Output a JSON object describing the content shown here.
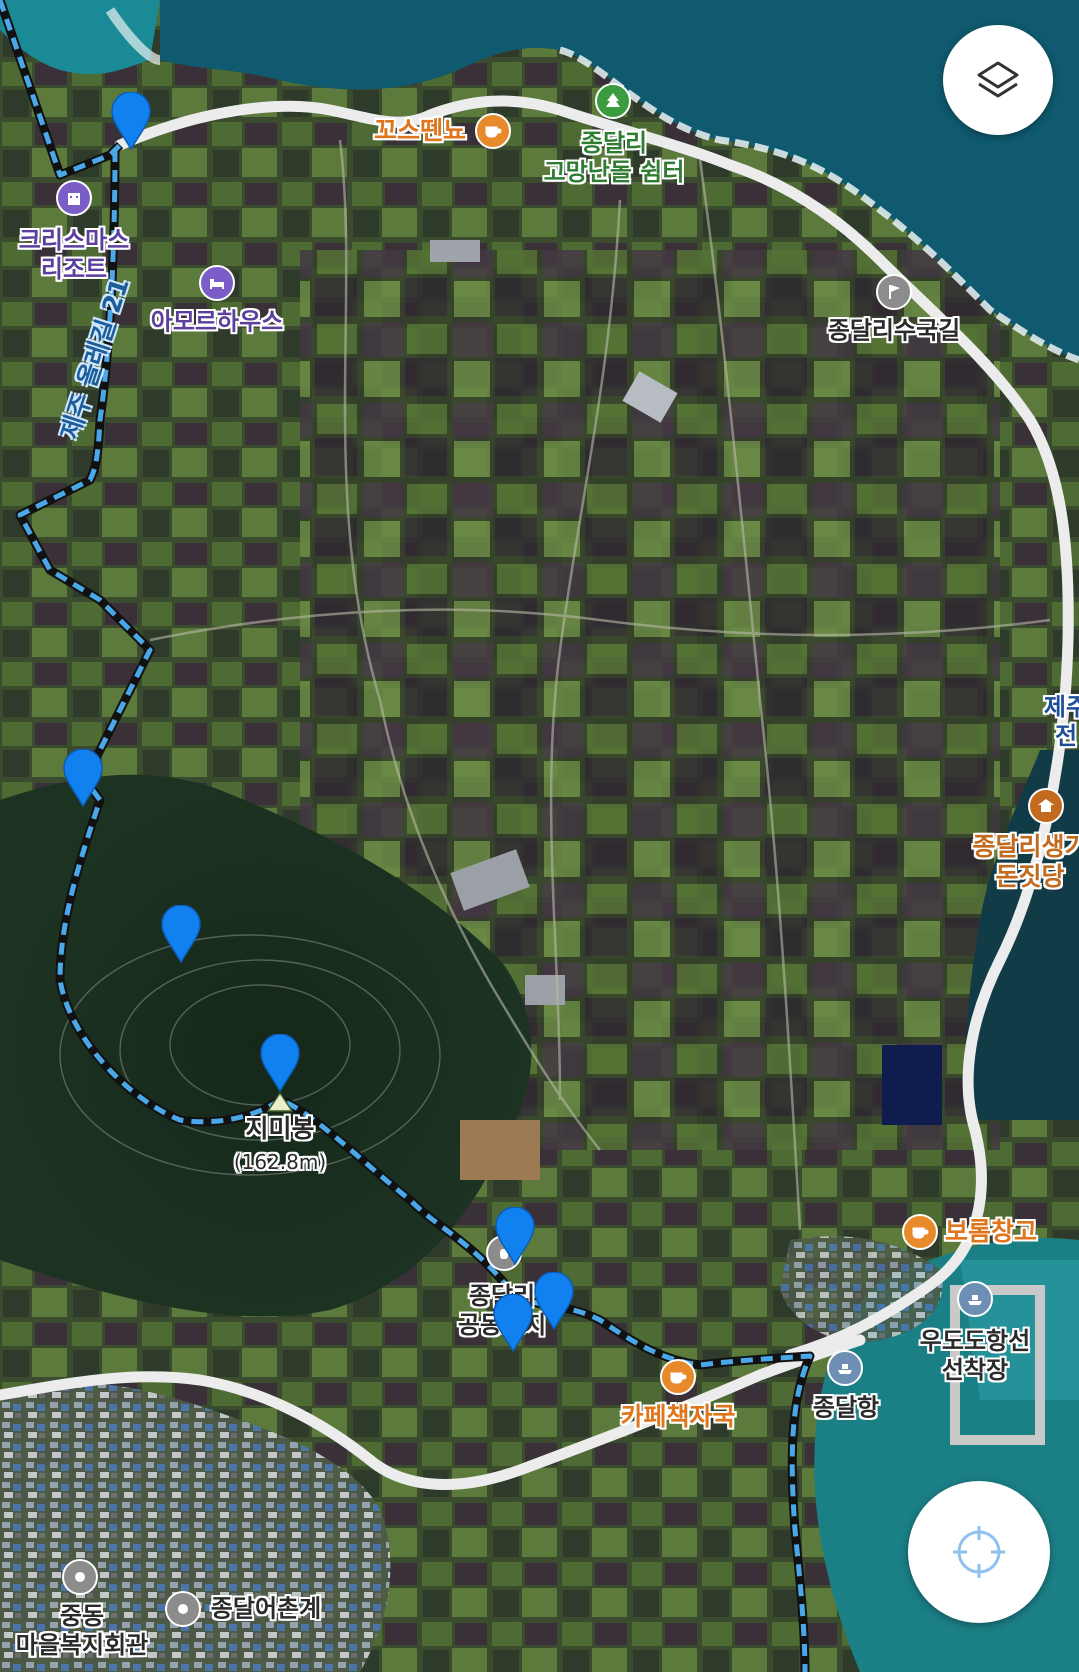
{
  "colors": {
    "sea": "#0f5a6e",
    "sea_light": "#1f8a93",
    "land": "#3a4a2c",
    "road": "#ececec",
    "route_blue": "#4aa8e8",
    "route_dark": "#111111",
    "pin_blue": "#1281f0",
    "cafe_orange": "#e88a2c",
    "lodging_purple": "#7b5dc8",
    "park_green": "#3a9b3f",
    "ferry_blue": "#6e8fb3",
    "gray_marker": "#8c8c8c"
  },
  "places": [
    {
      "id": "kkoseutteunyo",
      "name": "꼬스뗀뇨",
      "category": "cafe",
      "icon": "coffee-cup-icon"
    },
    {
      "id": "jongdal-gomang",
      "name": "종달리\n고망난돌 쉼터",
      "category": "park",
      "icon": "tree-icon"
    },
    {
      "id": "christmas-resort",
      "name": "크리스마스\n리조트",
      "category": "lodging",
      "icon": "building-icon"
    },
    {
      "id": "amor-house",
      "name": "아모르하우스",
      "category": "lodging",
      "icon": "bed-icon"
    },
    {
      "id": "suguk-gil",
      "name": "종달리수국길",
      "category": "landmark",
      "icon": "flag-icon"
    },
    {
      "id": "jejuolle-cut",
      "name": "제주\n전",
      "category": "landmark",
      "icon": ""
    },
    {
      "id": "dunjitdang",
      "name": "종달리생기\n돈짓당",
      "category": "shrine",
      "icon": "shrine-icon"
    },
    {
      "id": "borom",
      "name": "보롬창고",
      "category": "cafe",
      "icon": "coffee-cup-icon"
    },
    {
      "id": "udo-ferry",
      "name": "우도도항선\n선착장",
      "category": "ferry",
      "icon": "ferry-icon"
    },
    {
      "id": "jongdal-port",
      "name": "종달항",
      "category": "ferry",
      "icon": "ferry-icon"
    },
    {
      "id": "cafe-chaek",
      "name": "카페책자국",
      "category": "cafe",
      "icon": "coffee-cup-icon"
    },
    {
      "id": "cemetery",
      "name": "종달리\n공동묘지",
      "category": "landmark",
      "icon": "cemetery-icon"
    },
    {
      "id": "jungdong",
      "name": "중동\n마을복지회관",
      "category": "public",
      "icon": "circle-icon"
    },
    {
      "id": "fishing-village",
      "name": "종달어촌계",
      "category": "public",
      "icon": "circle-icon"
    }
  ],
  "peak": {
    "name": "지미봉",
    "elevation": "(162.8m)"
  },
  "route_name": "제주 올레길 21",
  "controls": {
    "layers": "layers-icon",
    "locate": "crosshair-icon"
  }
}
